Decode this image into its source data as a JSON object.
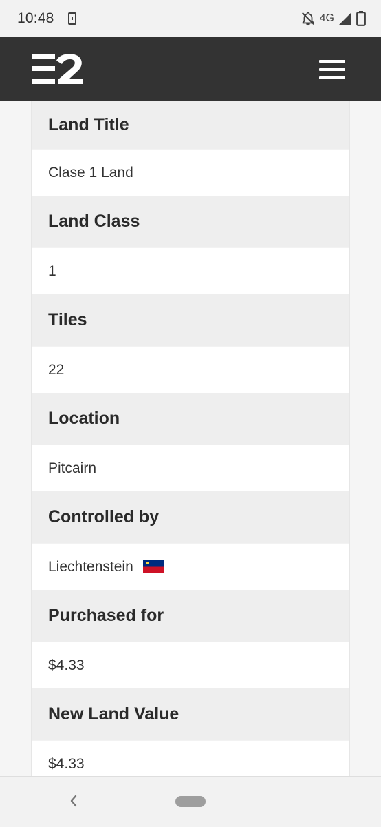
{
  "status_bar": {
    "time": "10:48",
    "network": "4G",
    "icons": [
      "phone-notification-icon",
      "bell-off-icon",
      "signal-icon",
      "battery-icon"
    ]
  },
  "header": {
    "logo_icon": "e2-logo-icon",
    "menu_icon": "hamburger-menu-icon",
    "background_color": "#333333"
  },
  "details": [
    {
      "label": "Land Title",
      "value": "Clase 1 Land"
    },
    {
      "label": "Land Class",
      "value": "1"
    },
    {
      "label": "Tiles",
      "value": "22"
    },
    {
      "label": "Location",
      "value": "Pitcairn"
    },
    {
      "label": "Controlled by",
      "value": "Liechtenstein",
      "flag_icon": "liechtenstein-flag-icon"
    },
    {
      "label": "Purchased for",
      "value": "$4.33"
    },
    {
      "label": "New Land Value",
      "value": "$4.33"
    }
  ],
  "nav_bar": {
    "back_icon": "back-chevron-icon",
    "home_icon": "home-pill-icon"
  },
  "colors": {
    "label_background": "#eeeeee",
    "value_background": "#ffffff",
    "flag_blue": "#002b7f",
    "flag_red": "#ce1126"
  }
}
